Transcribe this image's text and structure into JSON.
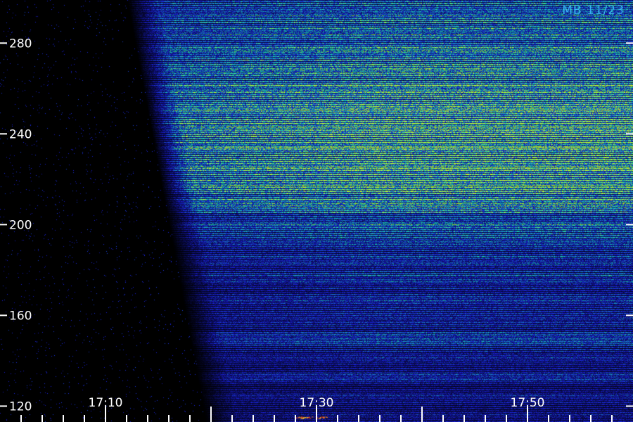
{
  "station_label": "MB 11/23",
  "colors": {
    "background": "#000000",
    "low": "#1a1fd9",
    "mid": "#14d6b4",
    "high": "#c9ff2a",
    "axis": "#ffffff"
  },
  "chart_data": {
    "type": "heatmap",
    "title": "",
    "xlabel": "",
    "ylabel": "",
    "x_ticks": [
      "17:10",
      "17:30",
      "17:50"
    ],
    "x_range": [
      "17:00",
      "18:00"
    ],
    "y_ticks": [
      120,
      160,
      200,
      240,
      280
    ],
    "y_range": [
      113,
      299
    ],
    "signal_onset": "17:16",
    "intensity_peak_band": [
      225,
      245
    ],
    "colormap": [
      "#000000",
      "#1a1fd9",
      "#14d6b4",
      "#c9ff2a"
    ]
  }
}
